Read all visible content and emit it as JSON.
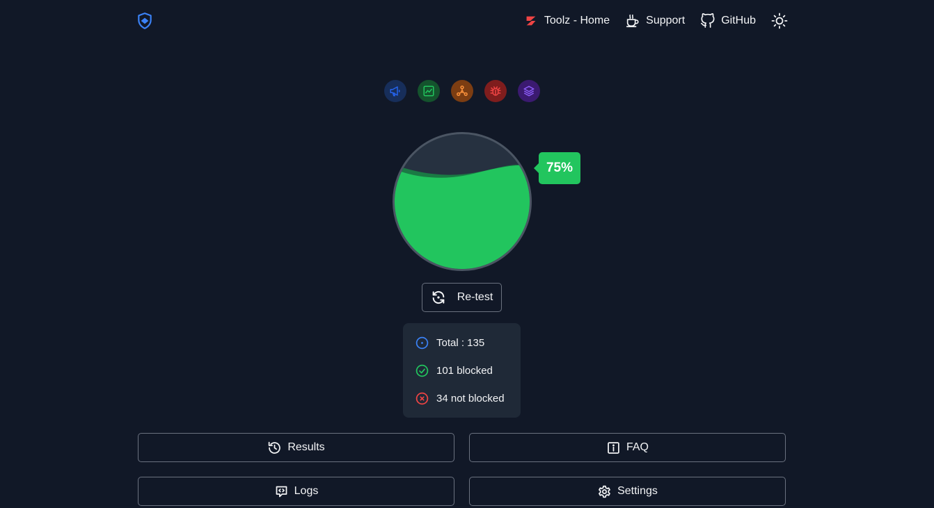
{
  "nav": {
    "home_label": "Toolz - Home",
    "support_label": "Support",
    "github_label": "GitHub"
  },
  "categories": [
    {
      "icon": "megaphone-icon",
      "color": "#1d4ed8",
      "bg": "#172e5a"
    },
    {
      "icon": "image-icon",
      "color": "#22c55e",
      "bg": "#14532d"
    },
    {
      "icon": "network-icon",
      "color": "#fb923c",
      "bg": "#7c3d12"
    },
    {
      "icon": "bug-icon",
      "color": "#ef4444",
      "bg": "#7f1d1d"
    },
    {
      "icon": "layers-icon",
      "color": "#8b5cf6",
      "bg": "#3b1a70"
    }
  ],
  "score": {
    "percent_label": "75%",
    "fill_fraction": 0.75,
    "fill_color": "#22c55e"
  },
  "retest_label": "Re-test",
  "stats": {
    "total": "Total : 135",
    "blocked": "101 blocked",
    "not_blocked": "34 not blocked"
  },
  "buttons": {
    "results": "Results",
    "faq": "FAQ",
    "logs": "Logs",
    "settings": "Settings"
  },
  "colors": {
    "background": "#111827",
    "panel": "#1f2937",
    "accent_green": "#22c55e",
    "accent_blue": "#3b82f6",
    "accent_red": "#ef4444"
  }
}
